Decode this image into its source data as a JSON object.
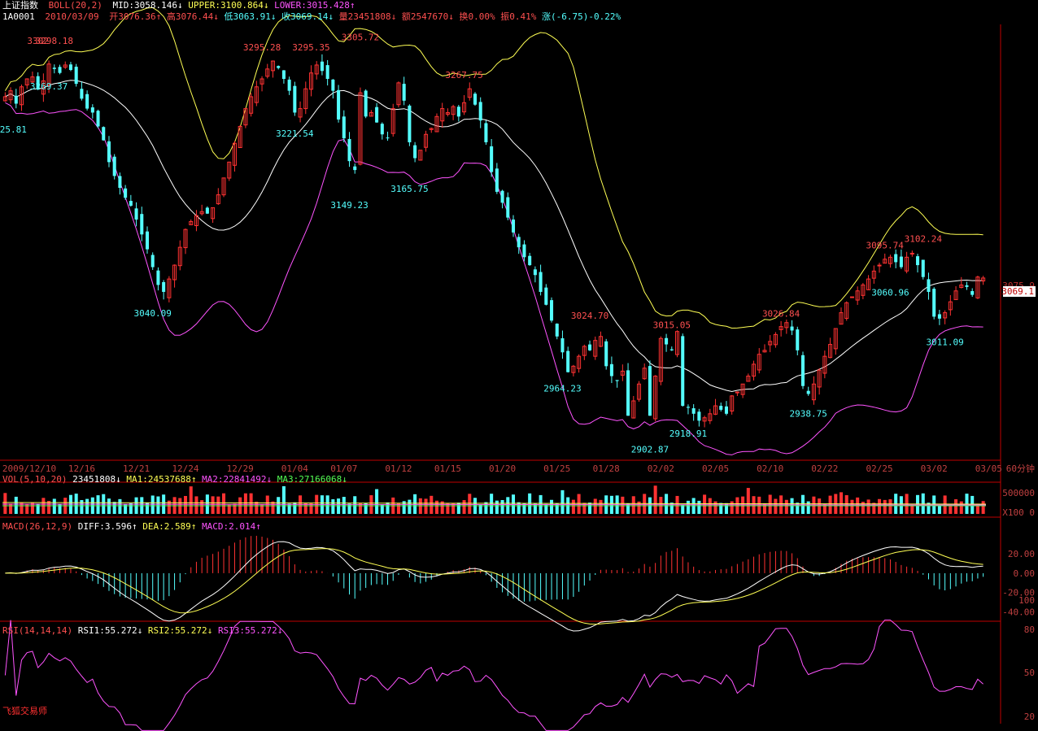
{
  "header": {
    "index_name": "上证指数",
    "boll": {
      "label": "BOLL(20,2)",
      "mid": "MID:3058.146↓",
      "upper": "UPPER:3100.864↓",
      "lower": "LOWER:3015.428↑"
    },
    "code": "1A0001",
    "date": "2010/03/09",
    "open": "开3076.36↑",
    "high": "高3076.44↓",
    "low": "低3063.91↓",
    "close": "收3069.14↓",
    "volume": "量23451808↓",
    "amount": "额2547670↓",
    "turnover": "换0.00%",
    "amplitude": "振0.41%",
    "change": "涨(-6.75)-0.22%"
  },
  "vol_header": {
    "label": "VOL(5,10,20)",
    "value": "23451808↓",
    "ma1": "MA1:24537688↑",
    "ma2": "MA2:22841492↓",
    "ma3": "MA3:27166068↓"
  },
  "macd_header": {
    "label": "MACD(26,12,9)",
    "diff": "DIFF:3.596↑",
    "dea": "DEA:2.589↑",
    "macd": "MACD:2.014↑"
  },
  "rsi_header": {
    "label": "RSI(14,14,14)",
    "rsi1": "RSI1:55.272↓",
    "rsi2": "RSI2:55.272↓",
    "rsi3": "RSI3:55.272↓"
  },
  "watermark": "飞狐交易师",
  "timeframe": "60分钟",
  "last_price_tag": "3069.1",
  "price_label_top": "3075.9",
  "colors": {
    "up": "#ff3232",
    "down": "#54ffff",
    "upper": "#ffff54",
    "mid": "#ffffff",
    "lower": "#ff54ff",
    "axis": "#c00000",
    "text_red": "#ff5050",
    "text_cyan": "#54ffff"
  },
  "chart_data": {
    "type": "candlestick",
    "date_ticks": [
      "2009/12/10",
      "12/16",
      "12/21",
      "12/24",
      "12/29",
      "01/04",
      "01/07",
      "01/12",
      "01/15",
      "01/20",
      "01/25",
      "01/28",
      "02/02",
      "02/05",
      "02/10",
      "02/22",
      "02/25",
      "03/02",
      "03/05"
    ],
    "price_range": [
      2890,
      3325
    ],
    "annotations_high": [
      {
        "text": "3302",
        "idx": 6,
        "price": 3302.0
      },
      {
        "text": "3298.18",
        "idx": 9,
        "price": 3302.0
      },
      {
        "text": "3295.28",
        "idx": 47,
        "price": 3295.28
      },
      {
        "text": "3295.35",
        "idx": 56,
        "price": 3295.35
      },
      {
        "text": "3305.72",
        "idx": 65,
        "price": 3305.72
      },
      {
        "text": "3267.75",
        "idx": 84,
        "price": 3267.75
      },
      {
        "text": "3024.70",
        "idx": 107,
        "price": 3024.7
      },
      {
        "text": "3015.05",
        "idx": 122,
        "price": 3015.05
      },
      {
        "text": "3026.84",
        "idx": 142,
        "price": 3026.84
      },
      {
        "text": "3095.74",
        "idx": 161,
        "price": 3095.74
      },
      {
        "text": "3102.24",
        "idx": 168,
        "price": 3102.24
      }
    ],
    "annotations_low": [
      {
        "text": "3269.37",
        "idx": 8,
        "price": 3269.37
      },
      {
        "text": "25.81",
        "idx": 0,
        "price": 3225.81
      },
      {
        "text": "3221.54",
        "idx": 53,
        "price": 3221.54
      },
      {
        "text": "3149.23",
        "idx": 63,
        "price": 3149.23
      },
      {
        "text": "3165.75",
        "idx": 74,
        "price": 3165.75
      },
      {
        "text": "3040.09",
        "idx": 27,
        "price": 3040.09
      },
      {
        "text": "2964.23",
        "idx": 102,
        "price": 2964.23
      },
      {
        "text": "2902.87",
        "idx": 118,
        "price": 2902.87
      },
      {
        "text": "2918.91",
        "idx": 125,
        "price": 2918.91
      },
      {
        "text": "2938.75",
        "idx": 147,
        "price": 2938.75
      },
      {
        "text": "3060.96",
        "idx": 162,
        "price": 3060.96
      },
      {
        "text": "3011.09",
        "idx": 172,
        "price": 3011.09
      }
    ],
    "close": [
      3252,
      3258,
      3245,
      3262,
      3270,
      3272,
      3260,
      3268,
      3285,
      3280,
      3276,
      3284,
      3279,
      3265,
      3250,
      3240,
      3236,
      3222,
      3208,
      3186,
      3172,
      3160,
      3150,
      3142,
      3128,
      3113,
      3098,
      3080,
      3062,
      3055,
      3068,
      3082,
      3100,
      3118,
      3126,
      3132,
      3136,
      3134,
      3140,
      3153,
      3170,
      3186,
      3205,
      3222,
      3240,
      3252,
      3262,
      3270,
      3280,
      3288,
      3281,
      3270,
      3258,
      3236,
      3240,
      3260,
      3276,
      3284,
      3278,
      3270,
      3258,
      3229,
      3210,
      3187,
      3178,
      3256,
      3232,
      3236,
      3226,
      3214,
      3210,
      3240,
      3266,
      3248,
      3206,
      3190,
      3198,
      3214,
      3220,
      3232,
      3240,
      3236,
      3242,
      3232,
      3246,
      3260,
      3244,
      3228,
      3206,
      3176,
      3156,
      3145,
      3130,
      3115,
      3100,
      3090,
      3082,
      3072,
      3055,
      3042,
      3026,
      3010,
      2994,
      2974,
      2980,
      2990,
      3000,
      2996,
      3006,
      3010,
      2980,
      2970,
      2965,
      2975,
      2930,
      2945,
      2962,
      2978,
      2930,
      2970,
      3008,
      3002,
      2996,
      3015,
      2940,
      2938,
      2932,
      2925,
      2928,
      2932,
      2940,
      2936,
      2932,
      2950,
      2954,
      2962,
      2970,
      2982,
      2992,
      2996,
      3005,
      3012,
      3020,
      3024,
      3016,
      2996,
      2960,
      2952,
      2962,
      2976,
      2990,
      3002,
      3018,
      3034,
      3044,
      3050,
      3056,
      3062,
      3068,
      3076,
      3082,
      3088,
      3090,
      3085,
      3080,
      3090,
      3094,
      3082,
      3070,
      3055,
      3030,
      3028,
      3034,
      3045,
      3056,
      3062,
      3060,
      3052,
      3070,
      3069
    ],
    "boll_upper": [],
    "boll_mid": [],
    "boll_lower": []
  }
}
